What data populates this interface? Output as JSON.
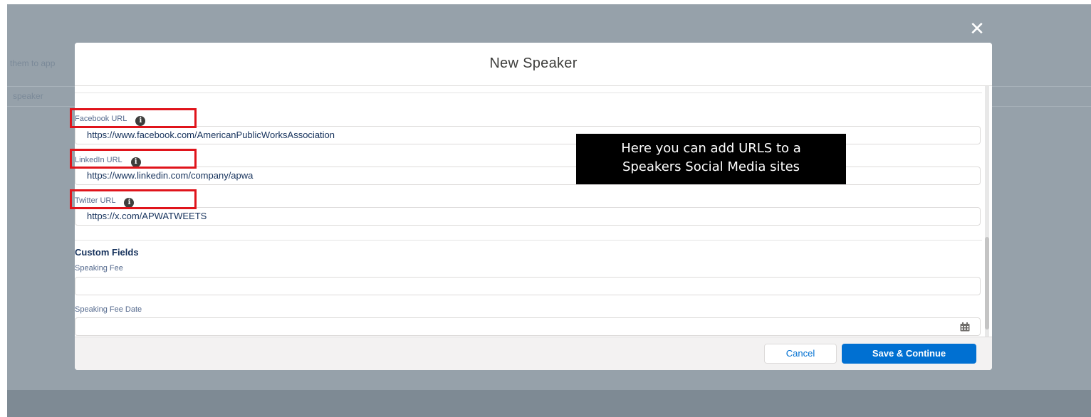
{
  "background": {
    "partial_text_1": "them to app",
    "partial_text_2": "speaker"
  },
  "modal": {
    "title": "New Speaker",
    "close_icon": "close-icon",
    "fields": [
      {
        "label": "Facebook URL",
        "value": "https://www.facebook.com/AmericanPublicWorksAssociation",
        "icon": "info-icon"
      },
      {
        "label": "LinkedIn URL",
        "value": "https://www.linkedin.com/company/apwa",
        "icon": "info-icon"
      },
      {
        "label": "Twitter URL",
        "value": "https://x.com/APWATWEETS",
        "icon": "info-icon"
      }
    ],
    "custom_fields": {
      "heading": "Custom Fields",
      "speaking_fee": {
        "label": "Speaking Fee",
        "value": ""
      },
      "speaking_fee_date": {
        "label": "Speaking Fee Date",
        "value": "",
        "icon": "calendar-icon"
      }
    },
    "footer": {
      "cancel_label": "Cancel",
      "save_label": "Save & Continue"
    }
  },
  "callout": {
    "line1": "Here you can add URLS to a",
    "line2": "Speakers Social Media sites"
  },
  "colors": {
    "overlay": "#96a1aa",
    "brand_blue": "#0070d2",
    "highlight_red": "#e0141b",
    "callout_bg": "#000000"
  }
}
